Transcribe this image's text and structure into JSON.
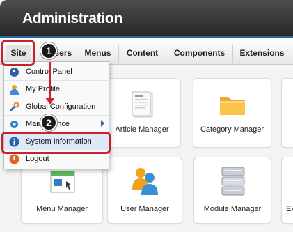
{
  "header": {
    "title": "Administration"
  },
  "menubar": {
    "items": [
      {
        "label": "Site"
      },
      {
        "label": "Users"
      },
      {
        "label": "Menus"
      },
      {
        "label": "Content"
      },
      {
        "label": "Components"
      },
      {
        "label": "Extensions"
      }
    ]
  },
  "dropdown": {
    "items": [
      {
        "label": "Control Panel",
        "icon": "control-panel-icon"
      },
      {
        "label": "My Profile",
        "icon": "user-profile-icon"
      },
      {
        "label": "Global Configuration",
        "icon": "wrench-icon"
      },
      {
        "label": "Maintenance",
        "icon": "gear-icon"
      },
      {
        "label": "System Information",
        "icon": "info-icon"
      },
      {
        "label": "Logout",
        "icon": "logout-icon"
      }
    ]
  },
  "tiles": [
    {
      "label": "Article Manager",
      "icon": "article-icon"
    },
    {
      "label": "Category Manager",
      "icon": "folder-icon"
    },
    {
      "label": "Menu Manager",
      "icon": "menu-manager-icon"
    },
    {
      "label": "User Manager",
      "icon": "users-icon"
    },
    {
      "label": "Module Manager",
      "icon": "module-stack-icon"
    }
  ],
  "callouts": {
    "step1": "1",
    "step2": "2"
  },
  "colors": {
    "accent_blue": "#2b63a5",
    "callout_red": "#c8232c",
    "header_dark": "#333333"
  }
}
